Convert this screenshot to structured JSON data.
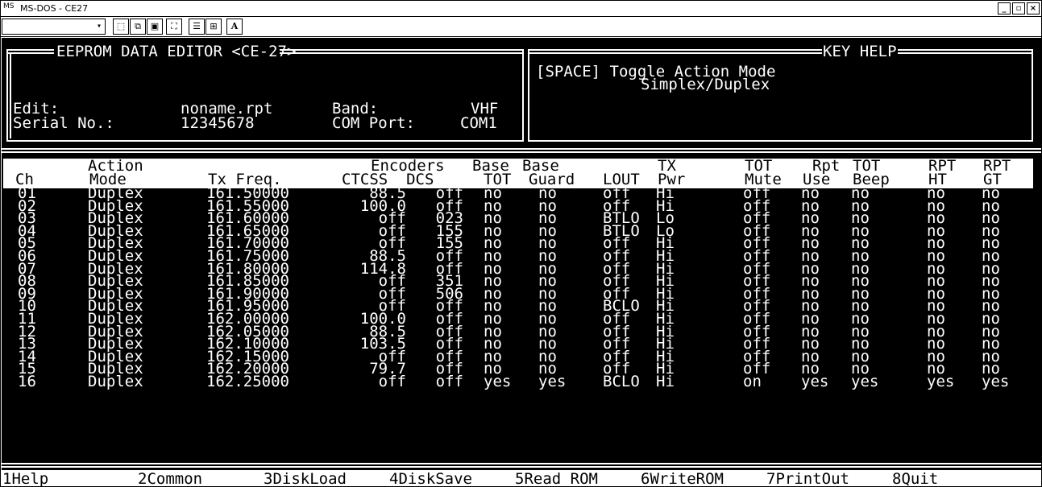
{
  "window": {
    "title": "MS-DOS - CE27",
    "icon": "ms-dos-icon",
    "buttons": [
      "minimize-icon",
      "maximize-icon",
      "close-icon"
    ]
  },
  "toolbar": {
    "font_select_value": "",
    "icons": [
      "mark-icon",
      "copy-icon",
      "paste-icon",
      "fullscreen-icon",
      "properties-icon",
      "background-icon",
      "font-icon"
    ],
    "font_icon_label": "A"
  },
  "editor": {
    "title": "EEPROM DATA EDITOR <CE-27>",
    "edit_label": "Edit:",
    "edit_value": "noname.rpt",
    "band_label": "Band:",
    "band_value": "VHF",
    "serial_label": "Serial No.:",
    "serial_value": "12345678",
    "com_label": "COM Port:",
    "com_value": "COM1"
  },
  "keyhelp": {
    "title": "KEY HELP",
    "line1": "[SPACE] Toggle Action Mode",
    "line2": "Simplex/Duplex"
  },
  "table": {
    "headers_top": [
      "",
      "Action",
      "",
      "Encoders",
      "Base",
      "Base",
      "",
      "TX",
      "TOT",
      "Rpt",
      "TOT",
      "RPT",
      "RPT"
    ],
    "headers_bottom": [
      "Ch",
      "Mode",
      "Tx Freq.",
      "CTCSS  DCS",
      "TOT",
      "Guard",
      "LOUT",
      "Pwr",
      "Mute",
      "Use",
      "Beep",
      "HT",
      "GT"
    ],
    "rows": [
      [
        "01",
        "Duplex",
        "161.50000",
        "88.5",
        "off",
        "no",
        "no",
        "off",
        "Hi",
        "off",
        "no",
        "no",
        "no",
        "no"
      ],
      [
        "02",
        "Duplex",
        "161.55000",
        "100.0",
        "off",
        "no",
        "no",
        "off",
        "Hi",
        "off",
        "no",
        "no",
        "no",
        "no"
      ],
      [
        "03",
        "Duplex",
        "161.60000",
        "off",
        "023",
        "no",
        "no",
        "BTLO",
        "Lo",
        "off",
        "no",
        "no",
        "no",
        "no"
      ],
      [
        "04",
        "Duplex",
        "161.65000",
        "off",
        "155",
        "no",
        "no",
        "BTLO",
        "Lo",
        "off",
        "no",
        "no",
        "no",
        "no"
      ],
      [
        "05",
        "Duplex",
        "161.70000",
        "off",
        "155",
        "no",
        "no",
        "off",
        "Hi",
        "off",
        "no",
        "no",
        "no",
        "no"
      ],
      [
        "06",
        "Duplex",
        "161.75000",
        "88.5",
        "off",
        "no",
        "no",
        "off",
        "Hi",
        "off",
        "no",
        "no",
        "no",
        "no"
      ],
      [
        "07",
        "Duplex",
        "161.80000",
        "114.8",
        "off",
        "no",
        "no",
        "off",
        "Hi",
        "off",
        "no",
        "no",
        "no",
        "no"
      ],
      [
        "08",
        "Duplex",
        "161.85000",
        "off",
        "351",
        "no",
        "no",
        "off",
        "Hi",
        "off",
        "no",
        "no",
        "no",
        "no"
      ],
      [
        "09",
        "Duplex",
        "161.90000",
        "off",
        "506",
        "no",
        "no",
        "off",
        "Hi",
        "off",
        "no",
        "no",
        "no",
        "no"
      ],
      [
        "10",
        "Duplex",
        "161.95000",
        "off",
        "off",
        "no",
        "no",
        "BCLO",
        "Hi",
        "off",
        "no",
        "no",
        "no",
        "no"
      ],
      [
        "11",
        "Duplex",
        "162.00000",
        "100.0",
        "off",
        "no",
        "no",
        "off",
        "Hi",
        "off",
        "no",
        "no",
        "no",
        "no"
      ],
      [
        "12",
        "Duplex",
        "162.05000",
        "88.5",
        "off",
        "no",
        "no",
        "off",
        "Hi",
        "off",
        "no",
        "no",
        "no",
        "no"
      ],
      [
        "13",
        "Duplex",
        "162.10000",
        "103.5",
        "off",
        "no",
        "no",
        "off",
        "Hi",
        "off",
        "no",
        "no",
        "no",
        "no"
      ],
      [
        "14",
        "Duplex",
        "162.15000",
        "off",
        "off",
        "no",
        "no",
        "off",
        "Hi",
        "off",
        "no",
        "no",
        "no",
        "no"
      ],
      [
        "15",
        "Duplex",
        "162.20000",
        "79.7",
        "off",
        "no",
        "no",
        "off",
        "Hi",
        "off",
        "no",
        "no",
        "no",
        "no"
      ],
      [
        "16",
        "Duplex",
        "162.25000",
        "off",
        "off",
        "yes",
        "yes",
        "BCLO",
        "Hi",
        "on",
        "yes",
        "yes",
        "yes",
        "yes"
      ]
    ]
  },
  "fkeys": [
    "1Help",
    "2Common",
    "3DiskLoad",
    "4DiskSave",
    "5Read ROM",
    "6WriteROM",
    "7PrintOut",
    "8Quit"
  ]
}
